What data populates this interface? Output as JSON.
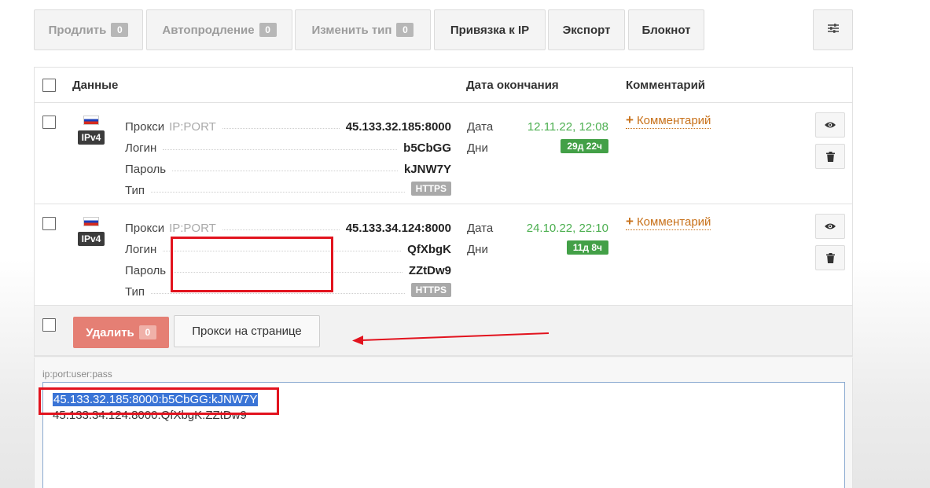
{
  "toolbar": {
    "buttons": [
      {
        "label": "Продлить",
        "count": "0"
      },
      {
        "label": "Автопродление",
        "count": "0"
      },
      {
        "label": "Изменить тип",
        "count": "0"
      },
      {
        "label": "Привязка к IP"
      },
      {
        "label": "Экспорт"
      },
      {
        "label": "Блокнот"
      }
    ],
    "settings_icon": "sliders-icon"
  },
  "table": {
    "headers": {
      "data": "Данные",
      "end_date": "Дата окончания",
      "comment": "Комментарий"
    },
    "labels": {
      "proxy": "Прокси",
      "proxy_hint": "IP:PORT",
      "login": "Логин",
      "password": "Пароль",
      "type": "Тип",
      "date": "Дата",
      "days": "Дни",
      "add_comment": "Комментарий"
    },
    "rows": [
      {
        "country_flag": "ru-flag-icon",
        "ip_version": "IPv4",
        "proxy": "45.133.32.185:8000",
        "login": "b5CbGG",
        "password": "kJNW7Y",
        "type": "HTTPS",
        "date": "12.11.22, 12:08",
        "days": "29д 22ч"
      },
      {
        "country_flag": "ru-flag-icon",
        "ip_version": "IPv4",
        "proxy": "45.133.34.124:8000",
        "login": "QfXbgK",
        "password": "ZZtDw9",
        "type": "HTTPS",
        "date": "24.10.22, 22:10",
        "days": "11д 8ч"
      }
    ]
  },
  "footer": {
    "delete_label": "Удалить",
    "delete_count": "0",
    "page_proxies_label": "Прокси на странице"
  },
  "export": {
    "format_label": "ip:port:user:pass",
    "lines": [
      "45.133.32.185:8000:b5CbGG:kJNW7Y",
      "45.133.34.124:8000:QfXbgK:ZZtDw9"
    ]
  },
  "colors": {
    "date_green": "#4caf50",
    "badge_green": "#43a047",
    "delete_red": "#e57f74",
    "comment_orange": "#c8711a",
    "highlight_red": "#e2131e",
    "selection_blue": "#3a74d6"
  }
}
